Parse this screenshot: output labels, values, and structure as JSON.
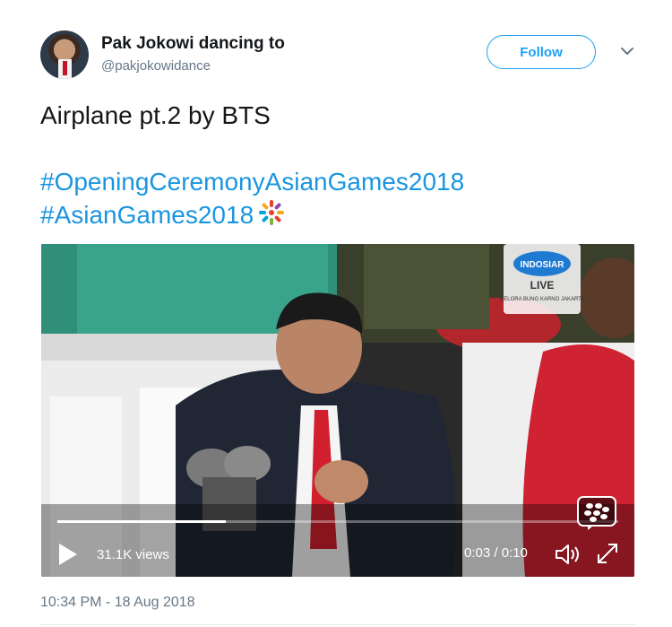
{
  "tweet": {
    "author_name": "Pak Jokowi dancing to",
    "author_handle": "@pakjokowidance",
    "follow_label": "Follow",
    "text_line1": "Airplane pt.2 by BTS",
    "hashtag1": "#OpeningCeremonyAsianGames2018",
    "hashtag2": "#AsianGames2018",
    "timestamp": "10:34 PM - 18 Aug 2018"
  },
  "video": {
    "views": "31.1K views",
    "time": "0:03 / 0:10",
    "progress": 0.3,
    "overlay_logo_text": "INDOSIAR",
    "overlay_live": "LIVE",
    "overlay_location": "GELORA BUNG KARNO JAKARTA"
  },
  "icons": {
    "caret": "chevron-down-icon",
    "play": "play-icon",
    "volume": "volume-icon",
    "fullscreen": "expand-icon"
  },
  "colors": {
    "accent": "#1da1f2",
    "hashtag": "#1b95e0",
    "secondary_text": "#657786"
  }
}
